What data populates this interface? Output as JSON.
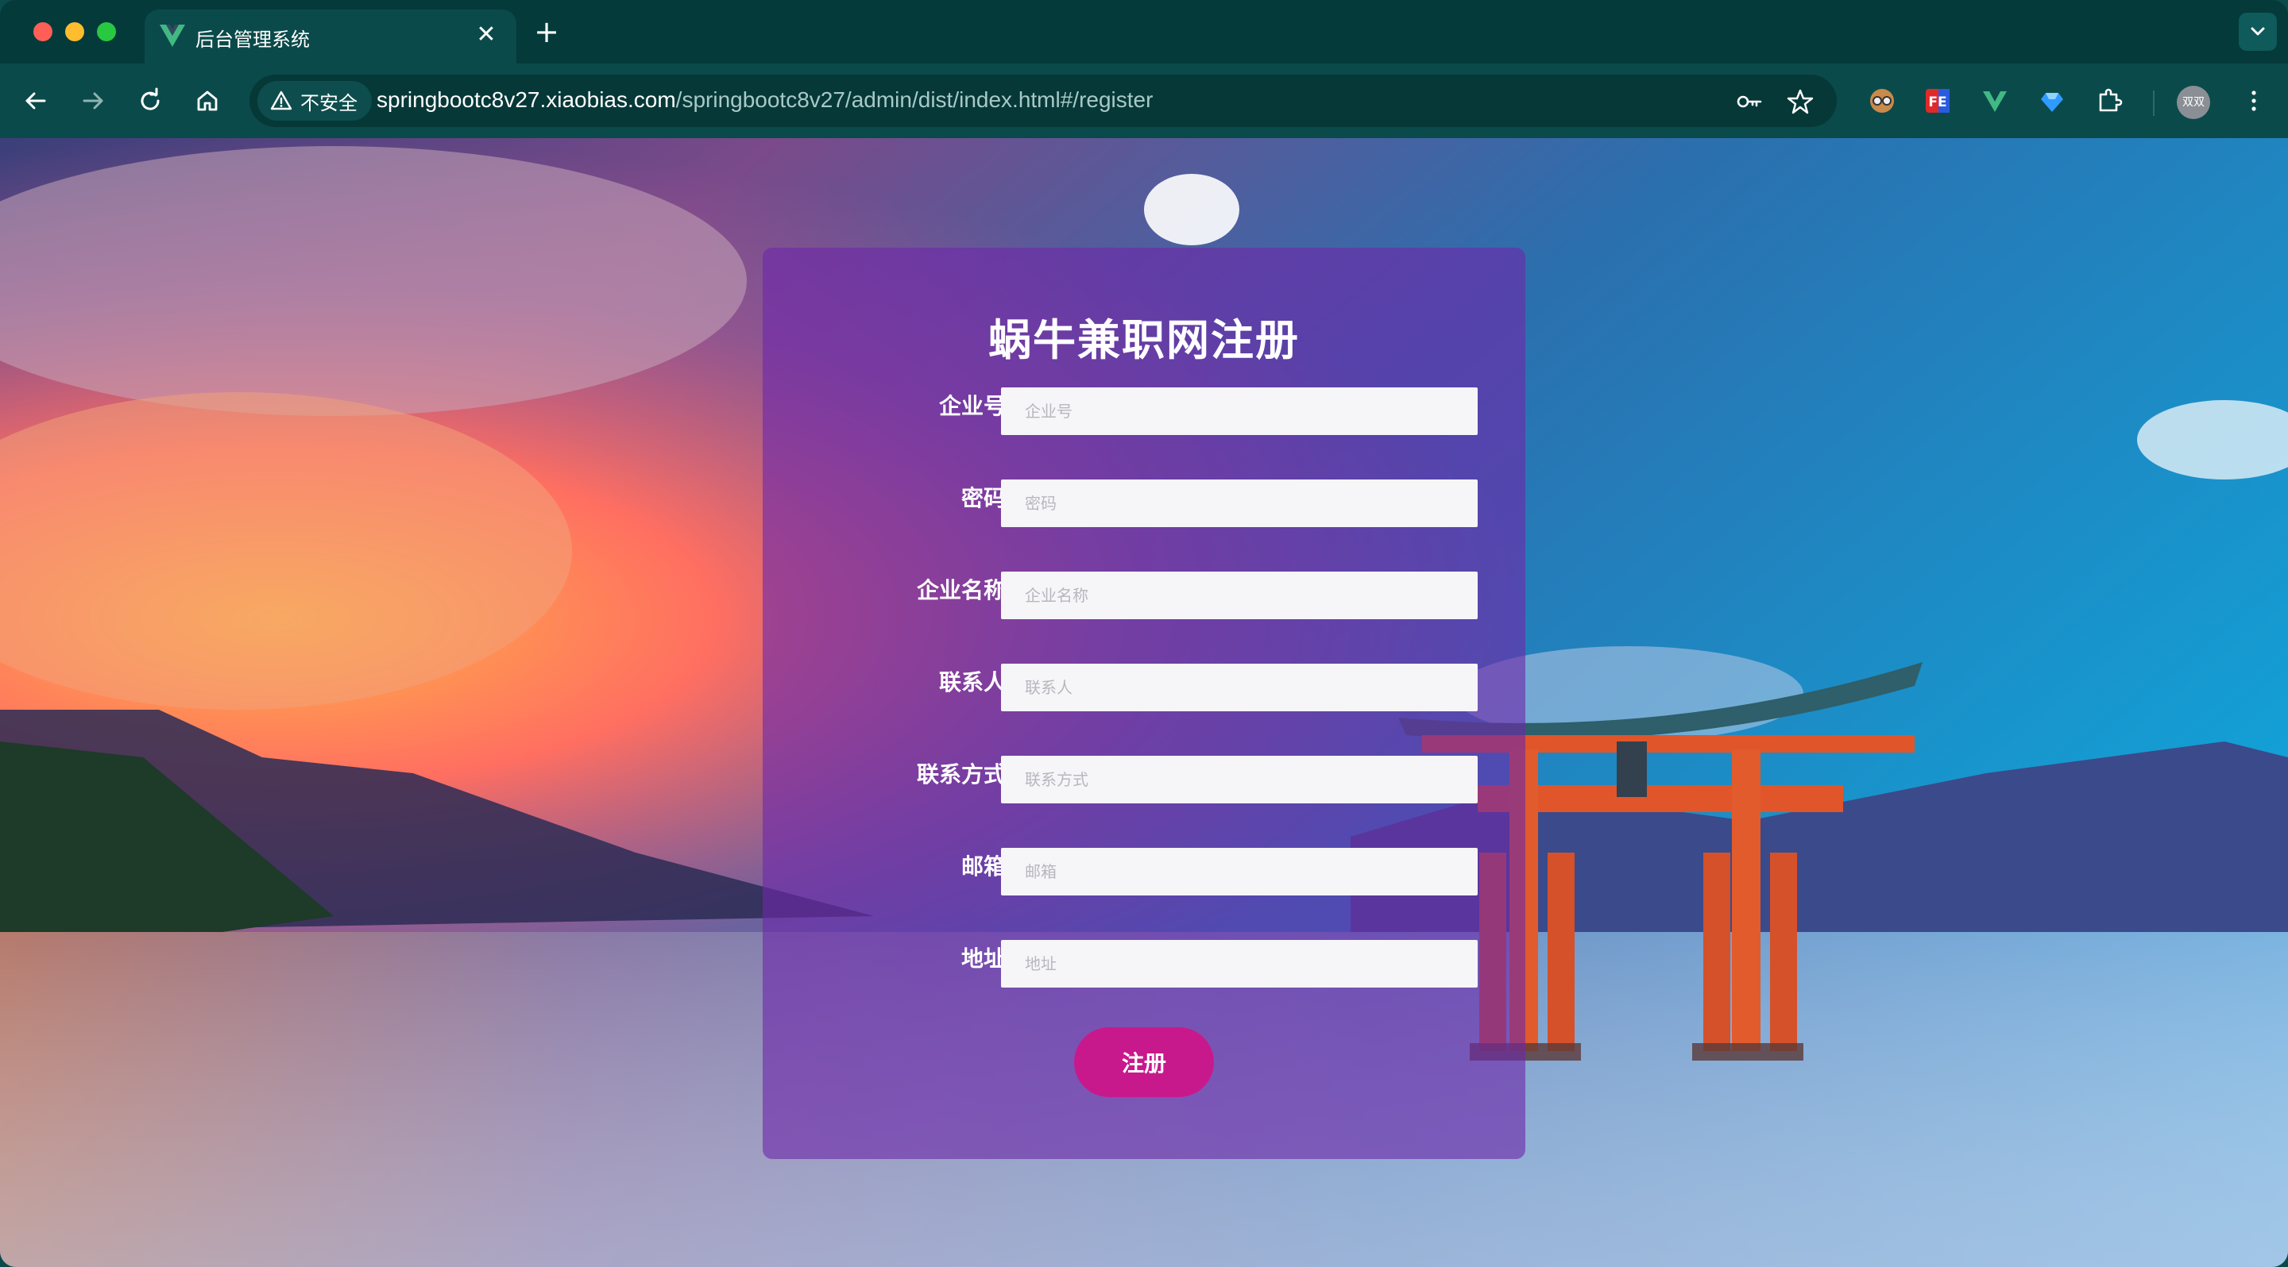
{
  "browser": {
    "tab_title": "后台管理系统",
    "tab_close_glyph": "✕",
    "new_tab_glyph": "+",
    "security_label": "不安全",
    "url_host": "springbootc8v27.xiaobias.com",
    "url_path": "/springbootc8v27/admin/dist/index.html#/register",
    "profile_initials": "双双",
    "icons": [
      "back-arrow-icon",
      "forward-arrow-icon",
      "reload-icon",
      "home-icon",
      "warning-triangle-icon",
      "password-key-icon",
      "bookmark-star-icon",
      "extensions-puzzle-icon",
      "kebab-menu-icon"
    ],
    "accent": "#0b4a4a"
  },
  "register": {
    "title": "蜗牛兼职网注册",
    "fields": [
      {
        "label": "企业号",
        "placeholder": "企业号",
        "value": ""
      },
      {
        "label": "密码",
        "placeholder": "密码",
        "value": ""
      },
      {
        "label": "企业名称",
        "placeholder": "企业名称",
        "value": ""
      },
      {
        "label": "联系人",
        "placeholder": "联系人",
        "value": ""
      },
      {
        "label": "联系方式",
        "placeholder": "联系方式",
        "value": ""
      },
      {
        "label": "邮箱",
        "placeholder": "邮箱",
        "value": ""
      },
      {
        "label": "地址",
        "placeholder": "地址",
        "value": ""
      }
    ],
    "submit_label": "注册",
    "button_color": "#c8198c",
    "card_color": "#6e28aa"
  }
}
